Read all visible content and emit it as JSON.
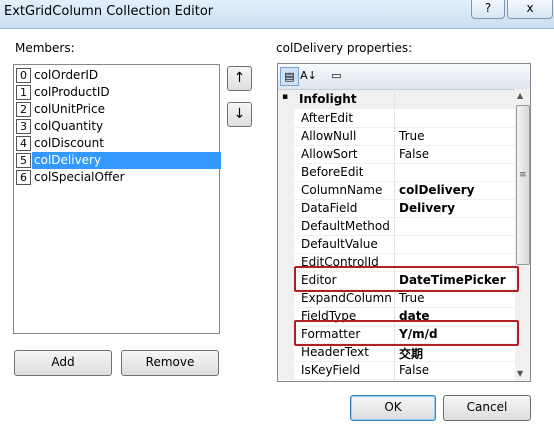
{
  "window": {
    "title": "ExtGridColumn Collection Editor",
    "help_button": "?",
    "close_button": "x"
  },
  "members": {
    "label": "Members:",
    "items": [
      {
        "index": "0",
        "name": "colOrderID"
      },
      {
        "index": "1",
        "name": "colProductID"
      },
      {
        "index": "2",
        "name": "colUnitPrice"
      },
      {
        "index": "3",
        "name": "colQuantity"
      },
      {
        "index": "4",
        "name": "colDiscount"
      },
      {
        "index": "5",
        "name": "colDelivery"
      },
      {
        "index": "6",
        "name": "colSpecialOffer"
      }
    ],
    "selected_index": 5,
    "move_up": "↑",
    "move_down": "↓",
    "add_label": "Add",
    "remove_label": "Remove"
  },
  "properties": {
    "label": "colDelivery properties:",
    "toolbar": {
      "categorized_icon": "categorized-icon",
      "alphabetical_icon": "sort-az-icon",
      "pages_icon": "property-pages-icon",
      "categorized_glyph": "▤",
      "alphabetical_glyph": "A↓",
      "pages_glyph": "▭"
    },
    "category": "Infolight",
    "rows": [
      {
        "name": "AfterEdit",
        "value": "",
        "bold": false
      },
      {
        "name": "AllowNull",
        "value": "True",
        "bold": false
      },
      {
        "name": "AllowSort",
        "value": "False",
        "bold": false
      },
      {
        "name": "BeforeEdit",
        "value": "",
        "bold": false
      },
      {
        "name": "ColumnName",
        "value": "colDelivery",
        "bold": true
      },
      {
        "name": "DataField",
        "value": "Delivery",
        "bold": true
      },
      {
        "name": "DefaultMethod",
        "value": "",
        "bold": false
      },
      {
        "name": "DefaultValue",
        "value": "",
        "bold": false
      },
      {
        "name": "EditControlId",
        "value": "",
        "bold": false
      },
      {
        "name": "Editor",
        "value": "DateTimePicker",
        "bold": true
      },
      {
        "name": "ExpandColumn",
        "value": "True",
        "bold": false
      },
      {
        "name": "FieldType",
        "value": "date",
        "bold": true
      },
      {
        "name": "Formatter",
        "value": "Y/m/d",
        "bold": true
      },
      {
        "name": "HeaderText",
        "value": "交期",
        "bold": true
      },
      {
        "name": "IsKeyField",
        "value": "False",
        "bold": false
      }
    ],
    "scroll_up": "▲",
    "scroll_down": "▼",
    "scroll_grip": "≡",
    "collapse_glyph": "▪"
  },
  "footer": {
    "ok_label": "OK",
    "cancel_label": "Cancel"
  },
  "colors": {
    "selection": "#3399ff",
    "highlight_box": "#b02020"
  }
}
